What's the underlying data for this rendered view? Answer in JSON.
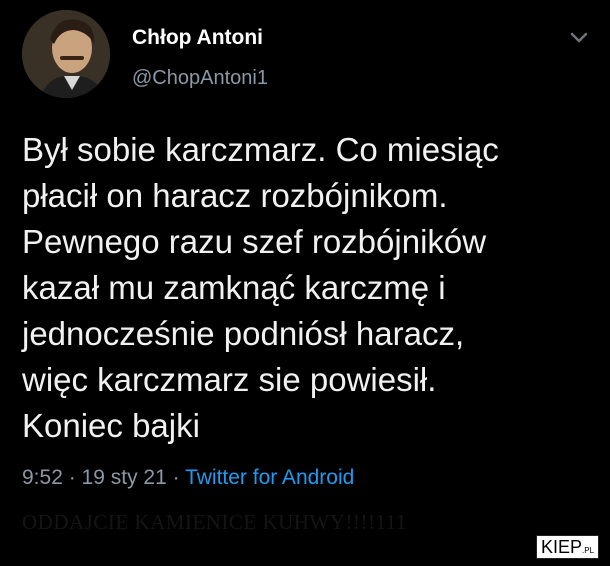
{
  "tweet": {
    "display_name": "Chłop Antoni",
    "handle": "@ChopAntoni1",
    "text_lines": [
      "Był sobie karczmarz. Co miesiąc",
      "płacił on haracz rozbójnikom.",
      "Pewnego razu szef rozbójników",
      "kazał mu zamknąć karczmę i",
      "jednocześnie podniósł haracz,",
      "więc karczmarz sie powiesił.",
      "Koniec bajki"
    ],
    "time": "9:52",
    "separator": " · ",
    "date": "19 sty 21",
    "source": "Twitter for Android",
    "menu_icon": "chevron-down-icon",
    "avatar_icon": "profile-photo"
  },
  "overlay": {
    "caption": "ODDAJCIE KAMIENICE KUHWY!!!!111",
    "watermark_main": "KIEP",
    "watermark_suffix": ".PL"
  },
  "colors": {
    "background": "#000000",
    "text": "#f1f1f1",
    "secondary": "#8b98a5",
    "link": "#1d9bf0"
  }
}
